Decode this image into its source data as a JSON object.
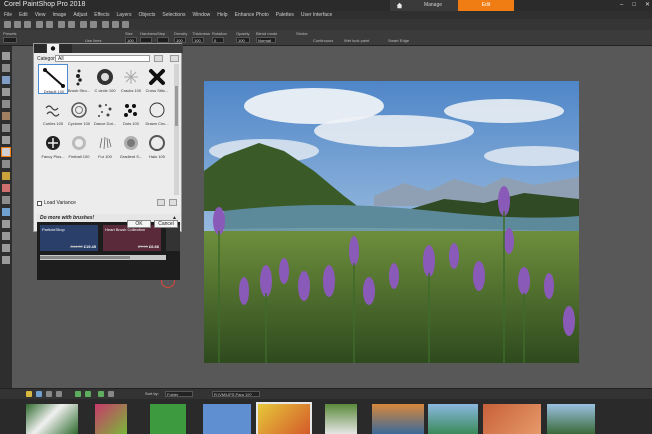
{
  "app": {
    "title": "Corel PaintShop Pro 2018",
    "workspace_tabs": [
      {
        "label": "",
        "icon": "home-icon"
      },
      {
        "label": "Manage"
      },
      {
        "label": "Edit"
      }
    ],
    "window_controls": [
      "–",
      "□",
      "✕"
    ]
  },
  "menubar": [
    "File",
    "Edit",
    "View",
    "Image",
    "Adjust",
    "Effects",
    "Layers",
    "Objects",
    "Selections",
    "Window",
    "Help",
    "Enhance Photo",
    "Palettes",
    "User Interface"
  ],
  "options_bar": {
    "labels": [
      "Presets",
      "Size",
      "Hardness",
      "Step",
      "Density",
      "Thickness",
      "Rotation",
      "Opacity",
      "Blend mode",
      "Stroke"
    ],
    "values": [
      "",
      "100",
      "",
      "",
      "100",
      "100",
      "0",
      "100",
      "Normal",
      ""
    ],
    "checkboxes": [
      "Use lines",
      "Continuous",
      "Wet look paint",
      "Smart Edge"
    ]
  },
  "brush_panel": {
    "category_label": "Category:",
    "category_value": "All",
    "brushes": [
      {
        "label": "Default 100",
        "selected": true
      },
      {
        "label": "Brush Stro...",
        "selected": false
      },
      {
        "label": "C circle 100",
        "selected": false
      },
      {
        "label": "Cracks 100",
        "selected": false
      },
      {
        "label": "Cross Stitc...",
        "selected": false
      },
      {
        "label": "Curlies 100",
        "selected": false
      },
      {
        "label": "Cyclone 100",
        "selected": false
      },
      {
        "label": "Dance Dot...",
        "selected": false
      },
      {
        "label": "Dots 100",
        "selected": false
      },
      {
        "label": "Drawn Circ...",
        "selected": false
      },
      {
        "label": "Fancy Plus...",
        "selected": false
      },
      {
        "label": "Fireball 100",
        "selected": false
      },
      {
        "label": "Fur 100",
        "selected": false
      },
      {
        "label": "Gradient S...",
        "selected": false
      },
      {
        "label": "Halo 100",
        "selected": false
      }
    ],
    "load_variance_label": "Load Variance",
    "promo_header": "Do more with brushes!",
    "promo_cards": [
      {
        "title": "ParticleShop",
        "old_price": "£44.00",
        "new_price": "£19.45"
      },
      {
        "title": "Heart Brush Collection",
        "old_price": "£7.99",
        "new_price": "£6.66"
      },
      {
        "title": "",
        "old_price": "",
        "new_price": ""
      }
    ],
    "ok_label": "OK",
    "cancel_label": "Cancel"
  },
  "organizer": {
    "sort_label": "Sort by:",
    "sort_value": "Folder",
    "folder_value": "R:\\VM\\UPS Paro 19?"
  },
  "colors": {
    "accent": "#f07c14",
    "selection_blue": "#4a8bd4",
    "cursor_red": "#d94a3a"
  }
}
